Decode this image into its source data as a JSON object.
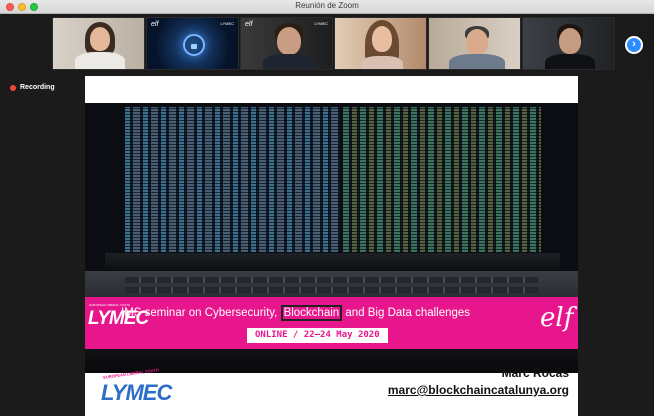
{
  "window": {
    "title": "Reunión de Zoom"
  },
  "strip": {
    "participants": [
      {
        "id": "p1"
      },
      {
        "id": "p2"
      },
      {
        "id": "p3"
      },
      {
        "id": "p4"
      },
      {
        "id": "p5"
      },
      {
        "id": "p6"
      }
    ],
    "next_icon": "chevron-right-icon",
    "tile_logo_text": "elf",
    "tile_logo_small": "LYMEC"
  },
  "recording": {
    "label": "Recording",
    "color": "#f24141"
  },
  "slide": {
    "banner": {
      "logo": "LYMEC",
      "text_before": "IMS seminar on Cybersecurity, ",
      "text_highlight": "Blockchain",
      "text_after": " and Big Data challenges",
      "date": "ONLINE / 22–24 May 2020",
      "elf_logo": "elf",
      "color": "#e8168c"
    },
    "footer": {
      "lymec_tagline": "EUROPEAN LIBERAL YOUTH",
      "lymec_logo": "LYMEC",
      "speaker_name": "Marc Rocas",
      "speaker_email": "marc@blockchaincatalunya.org"
    }
  },
  "colors": {
    "accent": "#2d8cff",
    "lymec_blue": "#2d6fc6"
  }
}
